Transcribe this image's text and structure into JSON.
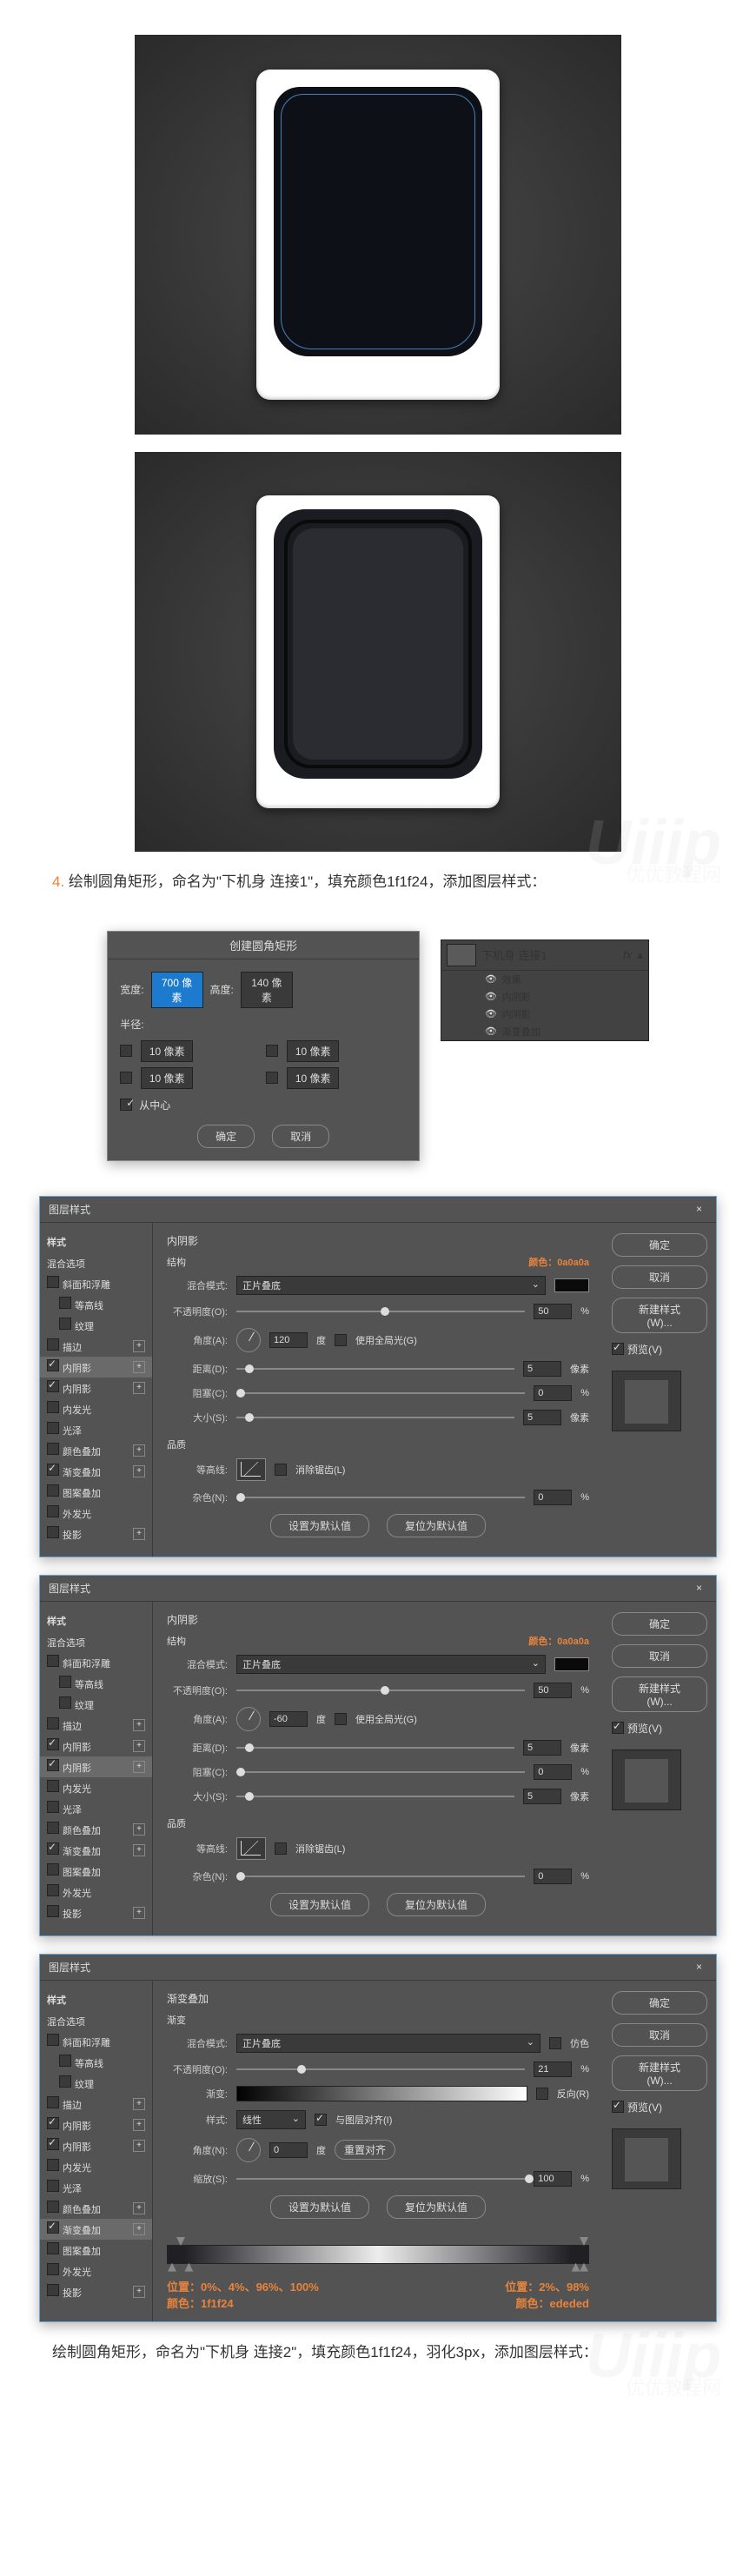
{
  "step4": {
    "num": "4.",
    "text": "绘制圆角矩形，命名为\"下机身 连接1\"，填充颜色1f1f24，添加图层样式："
  },
  "step5": {
    "text": "绘制圆角矩形，命名为\"下机身 连接2\"，填充颜色1f1f24，羽化3px，添加图层样式："
  },
  "rr": {
    "title": "创建圆角矩形",
    "w_lbl": "宽度:",
    "w_val": "700 像素",
    "h_lbl": "高度:",
    "h_val": "140 像素",
    "r_lbl": "半径:",
    "c1": "10 像素",
    "c2": "10 像素",
    "c3": "10 像素",
    "c4": "10 像素",
    "center": "从中心",
    "ok": "确定",
    "cancel": "取消"
  },
  "layers": {
    "name": "下机身  连接1",
    "fx": "fx",
    "effects": "效果",
    "e1": "内阴影",
    "e2": "内阴影",
    "e3": "渐变叠加"
  },
  "ls": {
    "title": "图层样式",
    "styles": "样式",
    "blend": "混合选项",
    "bevel": "斜面和浮雕",
    "contour": "等高线",
    "texture": "纹理",
    "stroke": "描边",
    "inshadow": "内阴影",
    "inglow": "内发光",
    "satin": "光泽",
    "colorO": "颜色叠加",
    "gradO": "渐变叠加",
    "patO": "图案叠加",
    "outglow": "外发光",
    "drop": "投影",
    "ok": "确定",
    "cancel": "取消",
    "newstyle": "新建样式(W)...",
    "preview": "预览(V)",
    "panelTitle": "内阴影",
    "panelTitle2": "渐变叠加",
    "struct": "结构",
    "colorLbl": "颜色：",
    "colorVal": "0a0a0a",
    "mode": "混合模式:",
    "modeV": "正片叠底",
    "opacity": "不透明度(O):",
    "opVal": "50",
    "opVal2": "50",
    "angle": "角度(A):",
    "angleV": "120",
    "angleV2": "-60",
    "deg": "度",
    "global": "使用全局光(G)",
    "dist": "距离(D):",
    "distV": "5",
    "px": "像素",
    "choke": "阻塞(C):",
    "chokeV": "0",
    "pct": "%",
    "size": "大小(S):",
    "sizeV": "5",
    "quality": "品质",
    "contourL": "等高线:",
    "anti": "消除锯齿(L)",
    "noise": "杂色(N):",
    "noiseV": "0",
    "default": "设置为默认值",
    "reset": "复位为默认值",
    "grad": "渐变",
    "dither": "仿色",
    "gradL": "渐变:",
    "reverse": "反向(R)",
    "style": "样式:",
    "styleV": "线性",
    "align": "与图层对齐(I)",
    "angleG": "角度(N):",
    "angleGV": "0",
    "resetA": "重置对齐",
    "scale": "缩放(S):",
    "scaleV": "100",
    "pos1": "位置：0%、4%、96%、100%",
    "pos2": "位置：2%、98%",
    "col1": "颜色：1f1f24",
    "col2": "颜色：ededed"
  }
}
